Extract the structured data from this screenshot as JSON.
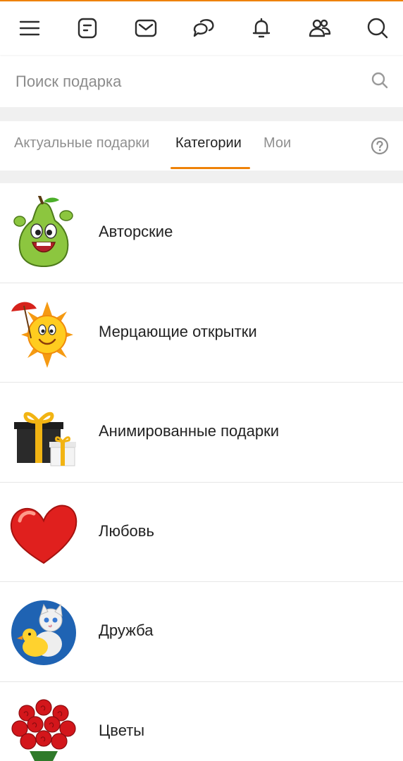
{
  "theme": {
    "accent": "#ee8208",
    "text": "#222222",
    "muted": "#8f8f8f",
    "divider": "#e6e6e6",
    "gap": "#f0f0f0"
  },
  "topbar": {
    "icons": [
      "menu-icon",
      "feed-icon",
      "mail-icon",
      "chat-icon",
      "bell-icon",
      "friends-icon",
      "search-icon"
    ]
  },
  "search": {
    "placeholder": "Поиск подарка",
    "value": ""
  },
  "tabs": [
    {
      "label": "Актуальные подарки",
      "active": false
    },
    {
      "label": "Категории",
      "active": true
    },
    {
      "label": "Мои",
      "active": false
    }
  ],
  "categories": [
    {
      "label": "Авторские",
      "icon": "pear-icon"
    },
    {
      "label": "Мерцающие открытки",
      "icon": "sun-icon"
    },
    {
      "label": "Анимированные подарки",
      "icon": "gift-boxes-icon"
    },
    {
      "label": "Любовь",
      "icon": "heart-icon"
    },
    {
      "label": "Дружба",
      "icon": "cat-duck-icon"
    },
    {
      "label": "Цветы",
      "icon": "roses-icon"
    }
  ]
}
